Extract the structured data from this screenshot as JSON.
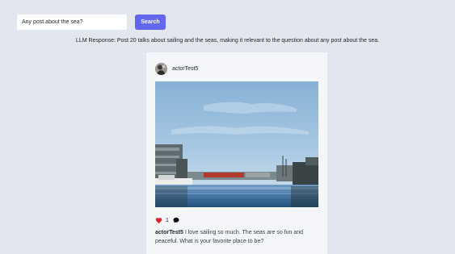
{
  "search": {
    "value": "Any post about the sea?",
    "placeholder": "",
    "button_label": "Search"
  },
  "llm_response": "LLM Response: Post 20 talks about sailing and the seas, making it relevant to the question about any post about the sea.",
  "post": {
    "username": "actorTest5",
    "likes": "1",
    "caption_user": "actorTest5",
    "caption_text": " I love sailing so much. The seas are so fun and peaceful. What is your favorite place to be?",
    "icons": [
      "heart-icon",
      "comment-icon"
    ]
  },
  "colors": {
    "background": "#e2e7ef",
    "card": "#f4f6fa",
    "accent": "#6366f1",
    "heart": "#e0262b"
  }
}
